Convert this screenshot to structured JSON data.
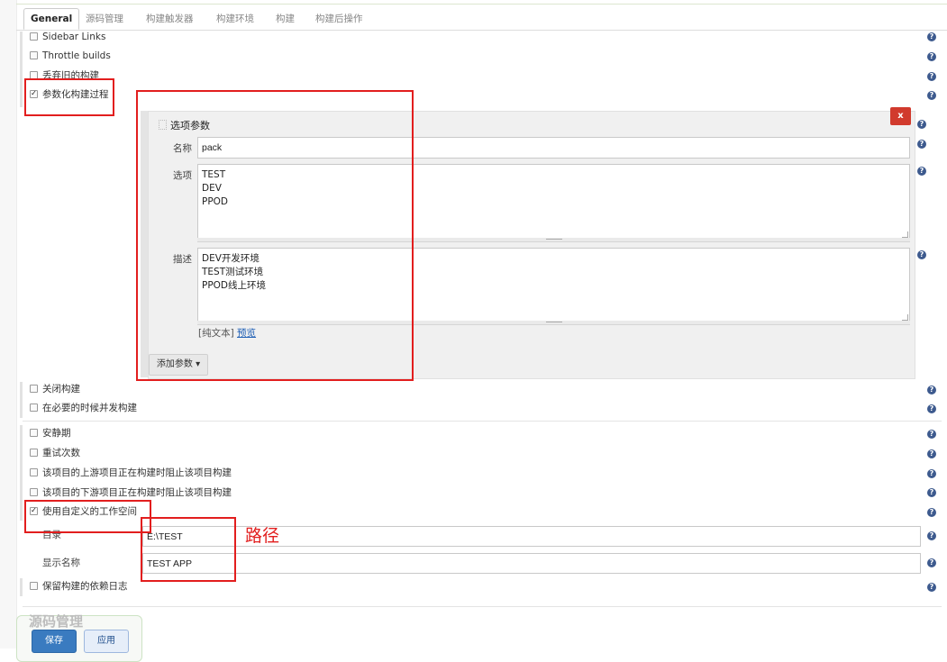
{
  "tabs": [
    {
      "label": "General",
      "active": true
    },
    {
      "label": "源码管理",
      "active": false
    },
    {
      "label": "构建触发器",
      "active": false
    },
    {
      "label": "构建环境",
      "active": false
    },
    {
      "label": "构建",
      "active": false
    },
    {
      "label": "构建后操作",
      "active": false
    }
  ],
  "options_top": [
    {
      "label": "Sidebar Links",
      "checked": false
    },
    {
      "label": "Throttle builds",
      "checked": false
    },
    {
      "label": "丢弃旧的构建",
      "checked": false
    },
    {
      "label": "参数化构建过程",
      "checked": true
    }
  ],
  "param_block": {
    "title": "选项参数",
    "delete_label": "x",
    "name_label": "名称",
    "name_value": "pack",
    "choices_label": "选项",
    "choices_value": "TEST\nDEV\nPPOD",
    "desc_label": "描述",
    "desc_value": "DEV开发环境\nTEST测试环境\nPPOD线上环境",
    "plain_text_prefix": "[纯文本]",
    "preview_link": "预览",
    "add_param_label": "添加参数",
    "add_param_arrow": "▾"
  },
  "options_mid": [
    {
      "label": "关闭构建",
      "checked": false
    },
    {
      "label": "在必要的时候并发构建",
      "checked": false
    },
    {
      "label": "安静期",
      "checked": false
    },
    {
      "label": "重试次数",
      "checked": false
    },
    {
      "label": "该项目的上游项目正在构建时阻止该项目构建",
      "checked": false
    },
    {
      "label": "该项目的下游项目正在构建时阻止该项目构建",
      "checked": false
    },
    {
      "label": "使用自定义的工作空间",
      "checked": true
    }
  ],
  "workspace": {
    "dir_label": "目录",
    "dir_value": "E:\\TEST",
    "display_label": "显示名称",
    "display_value": "TEST APP"
  },
  "options_bottom": [
    {
      "label": "保留构建的依赖日志",
      "checked": false
    }
  ],
  "annotation": "路径",
  "footer": {
    "section_title": "源码管理",
    "save_label": "保存",
    "apply_label": "应用"
  },
  "icons": {
    "help": "help-icon",
    "checkbox": "checkbox-icon",
    "drag": "drag-handle-icon"
  },
  "colors": {
    "accent": "#3a7bc0",
    "annotation_red": "#e21e1e",
    "help_icon": "#3d5a8e",
    "delete_red": "#d13a2d"
  }
}
